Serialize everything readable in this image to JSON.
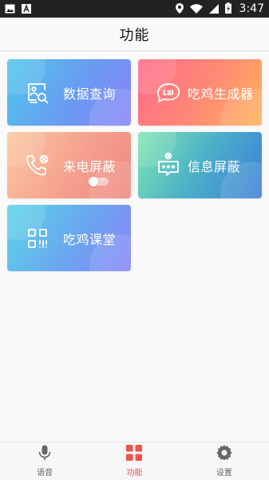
{
  "status_bar": {
    "time": "3:47",
    "icons": [
      "image-icon",
      "font-icon",
      "location-icon",
      "wifi-icon",
      "signal-icon",
      "battery-charging-icon"
    ]
  },
  "header": {
    "title": "功能"
  },
  "cards": [
    {
      "label": "数据查询",
      "icon": "data-search-icon"
    },
    {
      "label": "吃鸡生成器",
      "icon": "chat-bubble-icon"
    },
    {
      "label": "来电屏蔽",
      "icon": "phone-block-icon",
      "toggle": "off"
    },
    {
      "label": "信息屏蔽",
      "icon": "message-block-icon"
    },
    {
      "label": "吃鸡课堂",
      "icon": "qr-code-icon"
    }
  ],
  "tab_bar": {
    "tabs": [
      {
        "label": "语音",
        "icon": "microphone-icon",
        "active": false
      },
      {
        "label": "功能",
        "icon": "grid-icon",
        "active": true
      },
      {
        "label": "设置",
        "icon": "gear-icon",
        "active": false
      }
    ],
    "active_color": "#f0524a",
    "inactive_color": "#666666"
  }
}
